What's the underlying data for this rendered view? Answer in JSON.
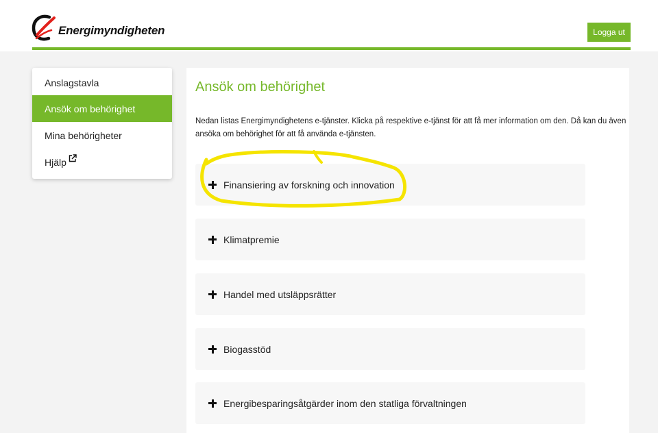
{
  "header": {
    "logo_text": "Energimyndigheten",
    "logout_label": "Logga ut"
  },
  "sidebar": {
    "items": [
      {
        "label": "Anslagstavla",
        "active": false
      },
      {
        "label": "Ansök om behörighet",
        "active": true
      },
      {
        "label": "Mina behörigheter",
        "active": false
      },
      {
        "label": "Hjälp",
        "active": false,
        "icon": "external-link-icon"
      }
    ]
  },
  "main": {
    "title": "Ansök om behörighet",
    "intro": "Nedan listas Energimyndighetens e-tjänster. Klicka på respektive e-tjänst för att få mer information om den. Då kan du även ansöka om behörighet för att få använda e-tjänsten.",
    "services": [
      {
        "label": "Finansiering av forskning och innovation",
        "icon": "plus-icon"
      },
      {
        "label": "Klimatpremie",
        "icon": "plus-icon"
      },
      {
        "label": "Handel med utsläppsrätter",
        "icon": "plus-icon"
      },
      {
        "label": "Biogasstöd",
        "icon": "plus-icon"
      },
      {
        "label": "Energibesparingsåtgärder inom den statliga förvaltningen",
        "icon": "plus-icon"
      }
    ]
  },
  "colors": {
    "brand_green": "#76b82a",
    "logo_red": "#e2211c",
    "highlight_yellow": "#f5e400",
    "page_background": "#f3f3f3",
    "accordion_background": "#f7f7f7"
  }
}
